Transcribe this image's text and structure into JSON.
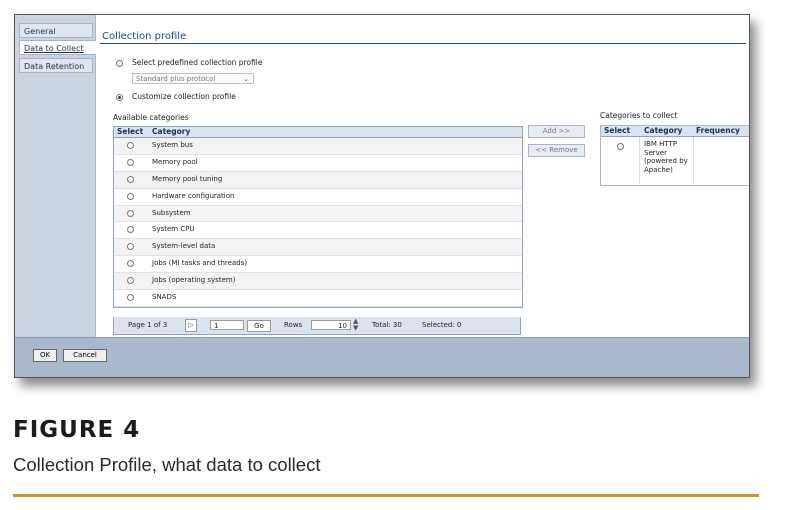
{
  "nav": {
    "tabs": [
      "General",
      "Data to Collect",
      "Data Retention"
    ],
    "active_index": 1
  },
  "panel": {
    "title": "Collection profile",
    "option_predefined": "Select predefined collection profile",
    "predefined_value": "Standard plus protocol",
    "option_customize": "Customize collection profile",
    "selected_option": "customize"
  },
  "available": {
    "label": "Available categories",
    "col_select": "Select",
    "col_category": "Category",
    "rows": [
      "System bus",
      "Memory pool",
      "Memory pool tuning",
      "Hardware configuration",
      "Subsystem",
      "System CPU",
      "System-level data",
      "Jobs (MI tasks and threads)",
      "Jobs (operating system)",
      "SNADS"
    ],
    "pager": {
      "page_text": "Page 1 of 3",
      "page_input": "1",
      "go_label": "Go",
      "rows_label": "Rows",
      "rows_value": "10",
      "total_text": "Total: 30",
      "selected_text": "Selected: 0"
    }
  },
  "actions": {
    "add_label": "Add >>",
    "remove_label": "<< Remove"
  },
  "collect": {
    "label": "Categories to collect",
    "col_select": "Select",
    "col_category": "Category",
    "col_frequency": "Frequency",
    "row_category": "IBM HTTP Server (powered by Apache)"
  },
  "footer": {
    "ok_label": "OK",
    "cancel_label": "Cancel"
  },
  "figure": {
    "label": "FIGURE 4",
    "caption": "Collection Profile, what data to collect"
  },
  "colors": {
    "nav_bg": "#c9d4e2",
    "accent": "#1a4d8c",
    "footer_bg": "#a9b8cd",
    "caption_rule": "#c8962a"
  }
}
